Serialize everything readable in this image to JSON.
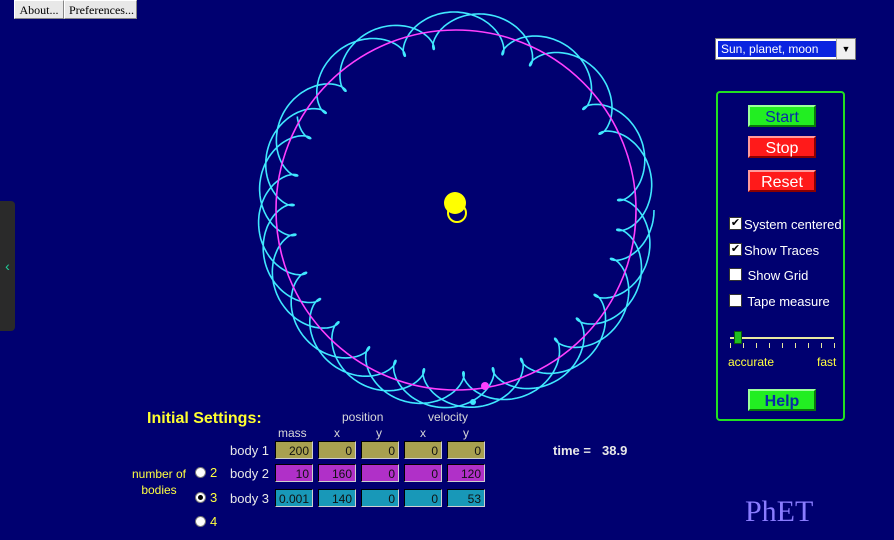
{
  "menu": {
    "about_label": "About...",
    "preferences_label": "Preferences..."
  },
  "sidebar_toggle": {
    "glyph": "‹",
    "icon": "chevron-left-icon"
  },
  "preset": {
    "selected": "Sun, planet, moon",
    "arrow": "▼"
  },
  "controls": {
    "start_label": "Start",
    "stop_label": "Stop",
    "reset_label": "Reset",
    "help_label": "Help",
    "system_centered": {
      "label": "System centered",
      "checked": true
    },
    "show_traces": {
      "label": "Show Traces",
      "checked": true
    },
    "show_grid": {
      "label": "Show Grid",
      "checked": false
    },
    "tape_measure": {
      "label": "Tape measure",
      "checked": false
    },
    "speed": {
      "min_label": "accurate",
      "max_label": "fast",
      "value": 0.08
    }
  },
  "settings": {
    "title": "Initial Settings:",
    "headers": {
      "mass": "mass",
      "position": "position",
      "velocity": "velocity",
      "x": "x",
      "y": "y"
    },
    "bodies": [
      {
        "label": "body 1",
        "mass": "200",
        "pos_x": "0",
        "pos_y": "0",
        "vel_x": "0",
        "vel_y": "0"
      },
      {
        "label": "body 2",
        "mass": "10",
        "pos_x": "160",
        "pos_y": "0",
        "vel_x": "0",
        "vel_y": "120"
      },
      {
        "label": "body 3",
        "mass": "0.001",
        "pos_x": "140",
        "pos_y": "0",
        "vel_x": "0",
        "vel_y": "53"
      }
    ],
    "number_of_bodies_label_1": "number of",
    "number_of_bodies_label_2": "bodies",
    "options": [
      "2",
      "3",
      "4"
    ],
    "selected_count": "3"
  },
  "time": {
    "label": "time =",
    "value": "38.9"
  },
  "logo": "PhET",
  "colors": {
    "background": "#000070",
    "sun": "#ffff00",
    "planet_orbit": "#ff40ff",
    "moon_trace": "#40e8ff",
    "panel_border": "#21e021"
  }
}
